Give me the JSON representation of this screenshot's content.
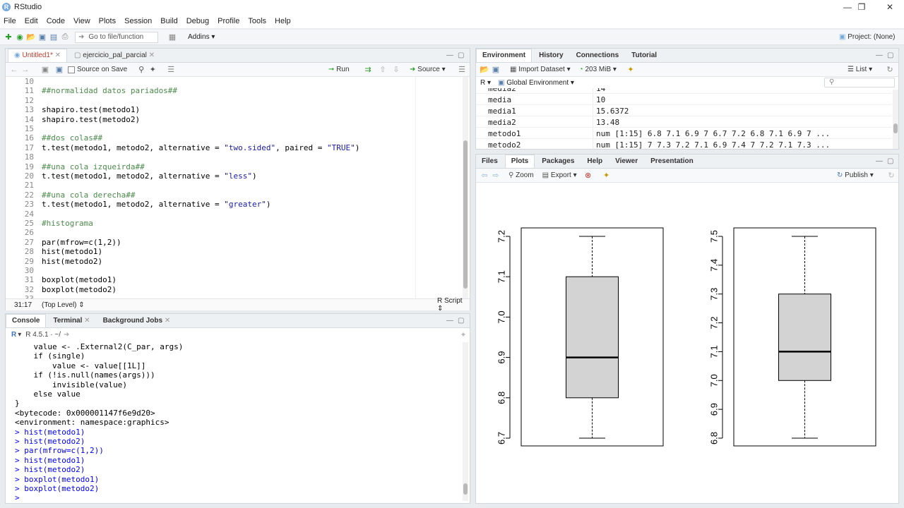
{
  "window": {
    "title": "RStudio",
    "app_icon": "R"
  },
  "menu": [
    "File",
    "Edit",
    "Code",
    "View",
    "Plots",
    "Session",
    "Build",
    "Debug",
    "Profile",
    "Tools",
    "Help"
  ],
  "main_toolbar": {
    "goto_placeholder": "Go to file/function",
    "addins": "Addins",
    "project": "Project: (None)"
  },
  "editor": {
    "tabs": [
      "Untitled1*",
      "ejercicio_pal_parcial"
    ],
    "toolbar": {
      "source_on_save": "Source on Save",
      "run": "Run",
      "source": "Source"
    },
    "lines": [
      {
        "n": "10",
        "t": "",
        "k": "code"
      },
      {
        "n": "11",
        "t": "##normalidad datos pariados##",
        "k": "comment"
      },
      {
        "n": "12",
        "t": "",
        "k": "code"
      },
      {
        "n": "13",
        "t": "shapiro.test(metodo1)",
        "k": "code"
      },
      {
        "n": "14",
        "t": "shapiro.test(metodo2)",
        "k": "code"
      },
      {
        "n": "15",
        "t": "",
        "k": "code"
      },
      {
        "n": "16",
        "t": "##dos colas##",
        "k": "comment"
      },
      {
        "n": "17",
        "t": "t.test(metodo1, metodo2, alternative = \"two.sided\", paired = \"TRUE\")",
        "k": "code"
      },
      {
        "n": "18",
        "t": "",
        "k": "code"
      },
      {
        "n": "19",
        "t": "##una cola izqueirda##",
        "k": "comment"
      },
      {
        "n": "20",
        "t": "t.test(metodo1, metodo2, alternative = \"less\")",
        "k": "code"
      },
      {
        "n": "21",
        "t": "",
        "k": "code"
      },
      {
        "n": "22",
        "t": "##una cola derecha##",
        "k": "comment"
      },
      {
        "n": "23",
        "t": "t.test(metodo1, metodo2, alternative = \"greater\")",
        "k": "code"
      },
      {
        "n": "24",
        "t": "",
        "k": "code"
      },
      {
        "n": "25",
        "t": "#histograma",
        "k": "comment"
      },
      {
        "n": "26",
        "t": "",
        "k": "code"
      },
      {
        "n": "27",
        "t": "par(mfrow=c(1,2))",
        "k": "code"
      },
      {
        "n": "28",
        "t": "hist(metodo1)",
        "k": "code"
      },
      {
        "n": "29",
        "t": "hist(metodo2)",
        "k": "code"
      },
      {
        "n": "30",
        "t": "",
        "k": "code"
      },
      {
        "n": "31",
        "t": "boxplot(metodo1)",
        "k": "code"
      },
      {
        "n": "32",
        "t": "boxplot(metodo2)",
        "k": "code"
      },
      {
        "n": "33",
        "t": "",
        "k": "code"
      }
    ],
    "status": {
      "position": "31:17",
      "scope": "(Top Level)",
      "type": "R Script"
    }
  },
  "console": {
    "tabs": [
      "Console",
      "Terminal",
      "Background Jobs"
    ],
    "version": "R 4.5.1 · ~/",
    "lines": [
      {
        "t": "    value <- .External2(C_par, args)",
        "cmd": false
      },
      {
        "t": "    if (single)",
        "cmd": false
      },
      {
        "t": "        value <- value[[1L]]",
        "cmd": false
      },
      {
        "t": "    if (!is.null(names(args)))",
        "cmd": false
      },
      {
        "t": "        invisible(value)",
        "cmd": false
      },
      {
        "t": "    else value",
        "cmd": false
      },
      {
        "t": "}",
        "cmd": false
      },
      {
        "t": "<bytecode: 0x000001147f6e9d20>",
        "cmd": false
      },
      {
        "t": "<environment: namespace:graphics>",
        "cmd": false
      },
      {
        "t": "> hist(metodo1)",
        "cmd": true
      },
      {
        "t": "> hist(metodo2)",
        "cmd": true
      },
      {
        "t": "> par(mfrow=c(1,2))",
        "cmd": true
      },
      {
        "t": "> hist(metodo1)",
        "cmd": true
      },
      {
        "t": "> hist(metodo2)",
        "cmd": true
      },
      {
        "t": "> boxplot(metodo1)",
        "cmd": true
      },
      {
        "t": "> boxplot(metodo2)",
        "cmd": true
      },
      {
        "t": "> ",
        "cmd": true
      }
    ]
  },
  "environment": {
    "tabs": [
      "Environment",
      "History",
      "Connections",
      "Tutorial"
    ],
    "import_dataset": "Import Dataset",
    "memory": "203 MiB",
    "view_mode": "List",
    "lang": "R",
    "scope": "Global Environment",
    "rows": [
      {
        "name": "media2",
        "value": "14"
      },
      {
        "name": "media",
        "value": "10"
      },
      {
        "name": "media1",
        "value": "15.6372"
      },
      {
        "name": "media2",
        "value": "13.48"
      },
      {
        "name": "metodo1",
        "value": "num [1:15] 6.8 7.1 6.9 7 6.7 7.2 6.8 7.1 6.9 7 ..."
      },
      {
        "name": "metodo2",
        "value": "num [1:15] 7 7.3 7.2 7.1 6.9 7.4 7 7.2 7.1 7.3 ..."
      }
    ]
  },
  "files_pane": {
    "tabs": [
      "Files",
      "Plots",
      "Packages",
      "Help",
      "Viewer",
      "Presentation"
    ],
    "zoom": "Zoom",
    "export": "Export",
    "publish": "Publish"
  },
  "chart_data": [
    {
      "type": "boxplot",
      "ylim": [
        6.7,
        7.2
      ],
      "yticks": [
        "6.7",
        "6.8",
        "6.9",
        "7.0",
        "7.1",
        "7.2"
      ],
      "min": 6.7,
      "q1": 6.8,
      "median": 6.9,
      "q3": 7.1,
      "max": 7.2
    },
    {
      "type": "boxplot",
      "ylim": [
        6.8,
        7.5
      ],
      "yticks": [
        "6.8",
        "6.9",
        "7.0",
        "7.1",
        "7.2",
        "7.3",
        "7.4",
        "7.5"
      ],
      "min": 6.8,
      "q1": 7.0,
      "median": 7.1,
      "q3": 7.3,
      "max": 7.5
    }
  ],
  "colors": {
    "box_fill": "#d3d3d3",
    "comment": "#4b8b4b",
    "string": "#1a1aa6",
    "console_cmd": "#0000ff"
  }
}
